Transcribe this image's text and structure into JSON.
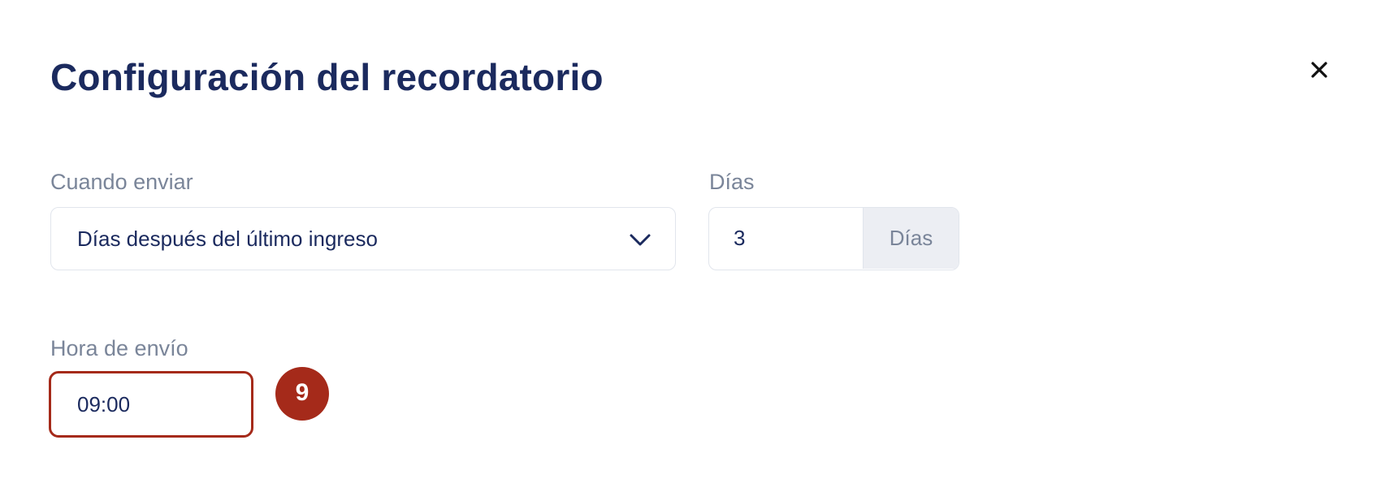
{
  "dialog": {
    "title": "Configuración del recordatorio",
    "close_icon": "close-icon"
  },
  "when_to_send": {
    "label": "Cuando enviar",
    "selected": "Días después del último ingreso",
    "icon": "chevron-down-icon"
  },
  "days": {
    "label": "Días",
    "value": "3",
    "unit": "Días"
  },
  "send_time": {
    "label": "Hora de envío",
    "value": "09:00"
  },
  "step_badge": {
    "number": "9"
  },
  "colors": {
    "title": "#1b2a5e",
    "label": "#7a8599",
    "border": "#e1e5ec",
    "addon_bg": "#eceef3",
    "highlight": "#a52a1a"
  }
}
